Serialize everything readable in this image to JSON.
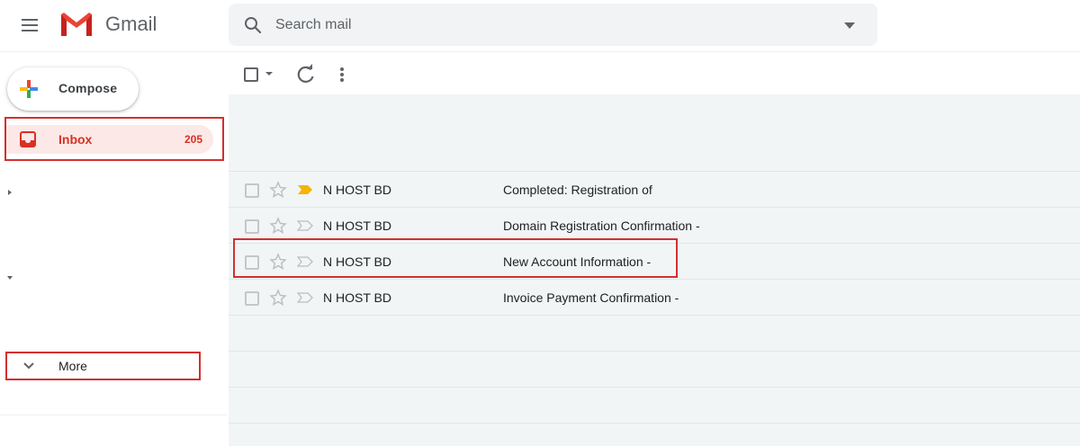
{
  "app": {
    "brand": "Gmail"
  },
  "search": {
    "placeholder": "Search mail"
  },
  "compose": {
    "label": "Compose"
  },
  "sidebar": {
    "inbox": {
      "label": "Inbox",
      "count": "205"
    },
    "more": {
      "label": "More"
    }
  },
  "messages": [
    {
      "sender": "N HOST BD",
      "subject": "Completed: Registration of",
      "important": true
    },
    {
      "sender": "N HOST BD",
      "subject": "Domain Registration Confirmation -",
      "important": false
    },
    {
      "sender": "N HOST BD",
      "subject": "New Account Information -",
      "important": false
    },
    {
      "sender": "N HOST BD",
      "subject": "Invoice Payment Confirmation -",
      "important": false
    }
  ],
  "colors": {
    "accent_red": "#d93025",
    "highlight_outline": "#d32f2f",
    "inbox_bg": "#fce8e6",
    "important_marker": "#f4b400",
    "list_bg": "#f2f5f5"
  },
  "icons": {
    "menu": "hamburger-menu-icon",
    "logo": "gmail-logo",
    "search": "search-icon",
    "search_options": "caret-down-icon",
    "compose": "plus-icon",
    "inbox": "inbox-icon",
    "more": "chevron-down-icon",
    "refresh": "refresh-icon",
    "more_actions": "more-vert-icon",
    "star": "star-icon",
    "important": "importance-marker-icon"
  }
}
